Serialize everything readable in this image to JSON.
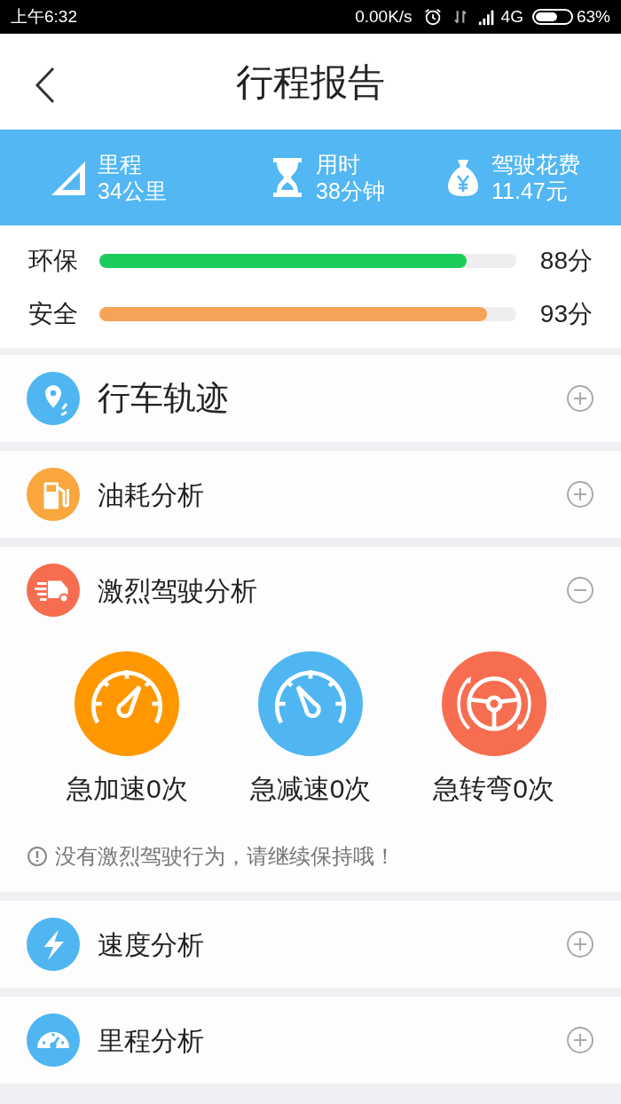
{
  "status_bar": {
    "time": "上午6:32",
    "speed": "0.00K/s",
    "network": "4G",
    "battery": "63%"
  },
  "header": {
    "title": "行程报告"
  },
  "summary": [
    {
      "label": "里程",
      "value": "34公里"
    },
    {
      "label": "用时",
      "value": "38分钟"
    },
    {
      "label": "驾驶花费",
      "value": "11.47元"
    }
  ],
  "scores": [
    {
      "label": "环保",
      "level": 0.88,
      "color": "#1ccc5b",
      "reading": "88分"
    },
    {
      "label": "安全",
      "level": 0.93,
      "color": "#f5a356",
      "reading": "93分"
    }
  ],
  "sections": [
    {
      "title": "行车轨迹",
      "color": "#4fb6f2",
      "expanded": false
    },
    {
      "title": "油耗分析",
      "color": "#f9a73e",
      "expanded": false
    },
    {
      "title": "激烈驾驶分析",
      "color": "#f76d50",
      "expanded": true,
      "events": [
        {
          "label": "急加速0次",
          "color": "#ff9800"
        },
        {
          "label": "急减速0次",
          "color": "#4fb6f2"
        },
        {
          "label": "急转弯0次",
          "color": "#f76d50"
        }
      ],
      "note": "没有激烈驾驶行为，请继续保持哦！"
    },
    {
      "title": "速度分析",
      "color": "#4fb6f2",
      "expanded": false
    },
    {
      "title": "里程分析",
      "color": "#4fb6f2",
      "expanded": false
    }
  ]
}
